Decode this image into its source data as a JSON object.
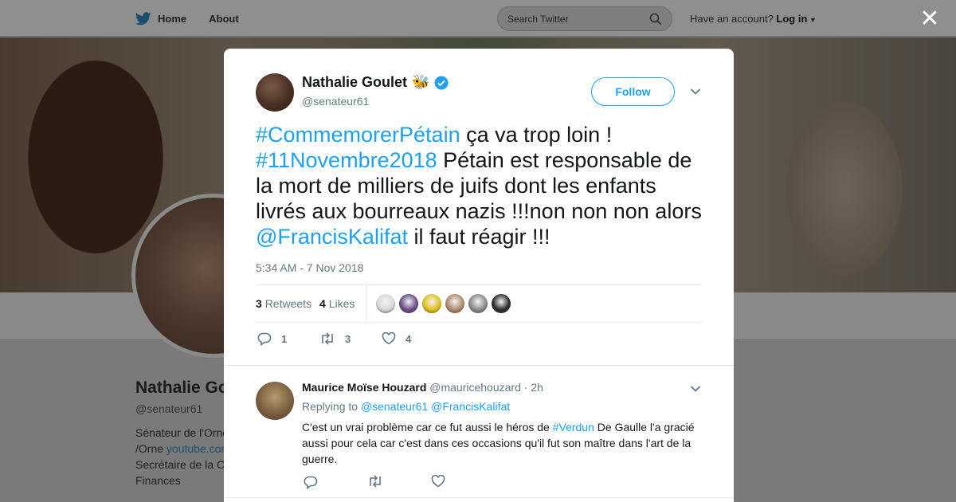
{
  "topbar": {
    "home_label": "Home",
    "about_label": "About",
    "search_placeholder": "Search Twitter",
    "account_prompt": "Have an account?",
    "login_label": "Log in"
  },
  "profile": {
    "name": "Nathalie Go",
    "handle": "@senateur61",
    "bio_line1": "Sénateur de l'Orne",
    "bio_line2_prefix": "/Orne ",
    "bio_line2_link": "youtube.con",
    "bio_line3": "Secrétaire de la C",
    "bio_line4": "Finances"
  },
  "tweet": {
    "author_name": "Nathalie Goulet",
    "author_emoji": "🐝",
    "author_handle": "@senateur61",
    "follow_label": "Follow",
    "text": {
      "tag1": "#CommemorerPétain",
      "t1": " ça va trop loin ! ",
      "tag2": "#11Novembre2018",
      "t2": " Pétain est responsable de la mort de milliers de juifs dont les enfants livrés aux bourreaux nazis !!!non non non alors ",
      "mention": "@FrancisKalifat",
      "t3": " il faut réagir !!!"
    },
    "timestamp": "5:34 AM - 7 Nov 2018",
    "retweets_count": "3",
    "retweets_label": "Retweets",
    "likes_count": "4",
    "likes_label": "Likes",
    "actions": {
      "replies": "1",
      "retweets": "3",
      "likes": "4"
    }
  },
  "likers": [
    {
      "icon": "liker-avatar-1",
      "color": "#d9d9d9"
    },
    {
      "icon": "liker-avatar-2",
      "color": "#6b4c8a"
    },
    {
      "icon": "liker-avatar-3",
      "color": "#e0c21a"
    },
    {
      "icon": "liker-avatar-4",
      "color": "#b08a6a"
    },
    {
      "icon": "liker-avatar-5",
      "color": "#8a8a8a"
    },
    {
      "icon": "liker-avatar-6",
      "color": "#2b2b2b"
    }
  ],
  "reply": {
    "name": "Maurice Moïse Houzard",
    "handle": "@mauricehouzard",
    "dot": "·",
    "time": "2h",
    "replying_label": "Replying to",
    "replying_to1": "@senateur61",
    "replying_to2": "@FrancisKalifat",
    "text_a": "C'est un vrai problème car ce fut aussi le héros de ",
    "tag": "#Verdun",
    "text_b": " De Gaulle l'a gracié aussi pour cela car c'est dans ces occasions qu'il fut son maître dans l'art de la guerre."
  },
  "colors": {
    "link": "#1da1f2",
    "text": "#14171a",
    "muted": "#657786",
    "overlay": "#7a7a7a"
  },
  "close_label": "✕"
}
